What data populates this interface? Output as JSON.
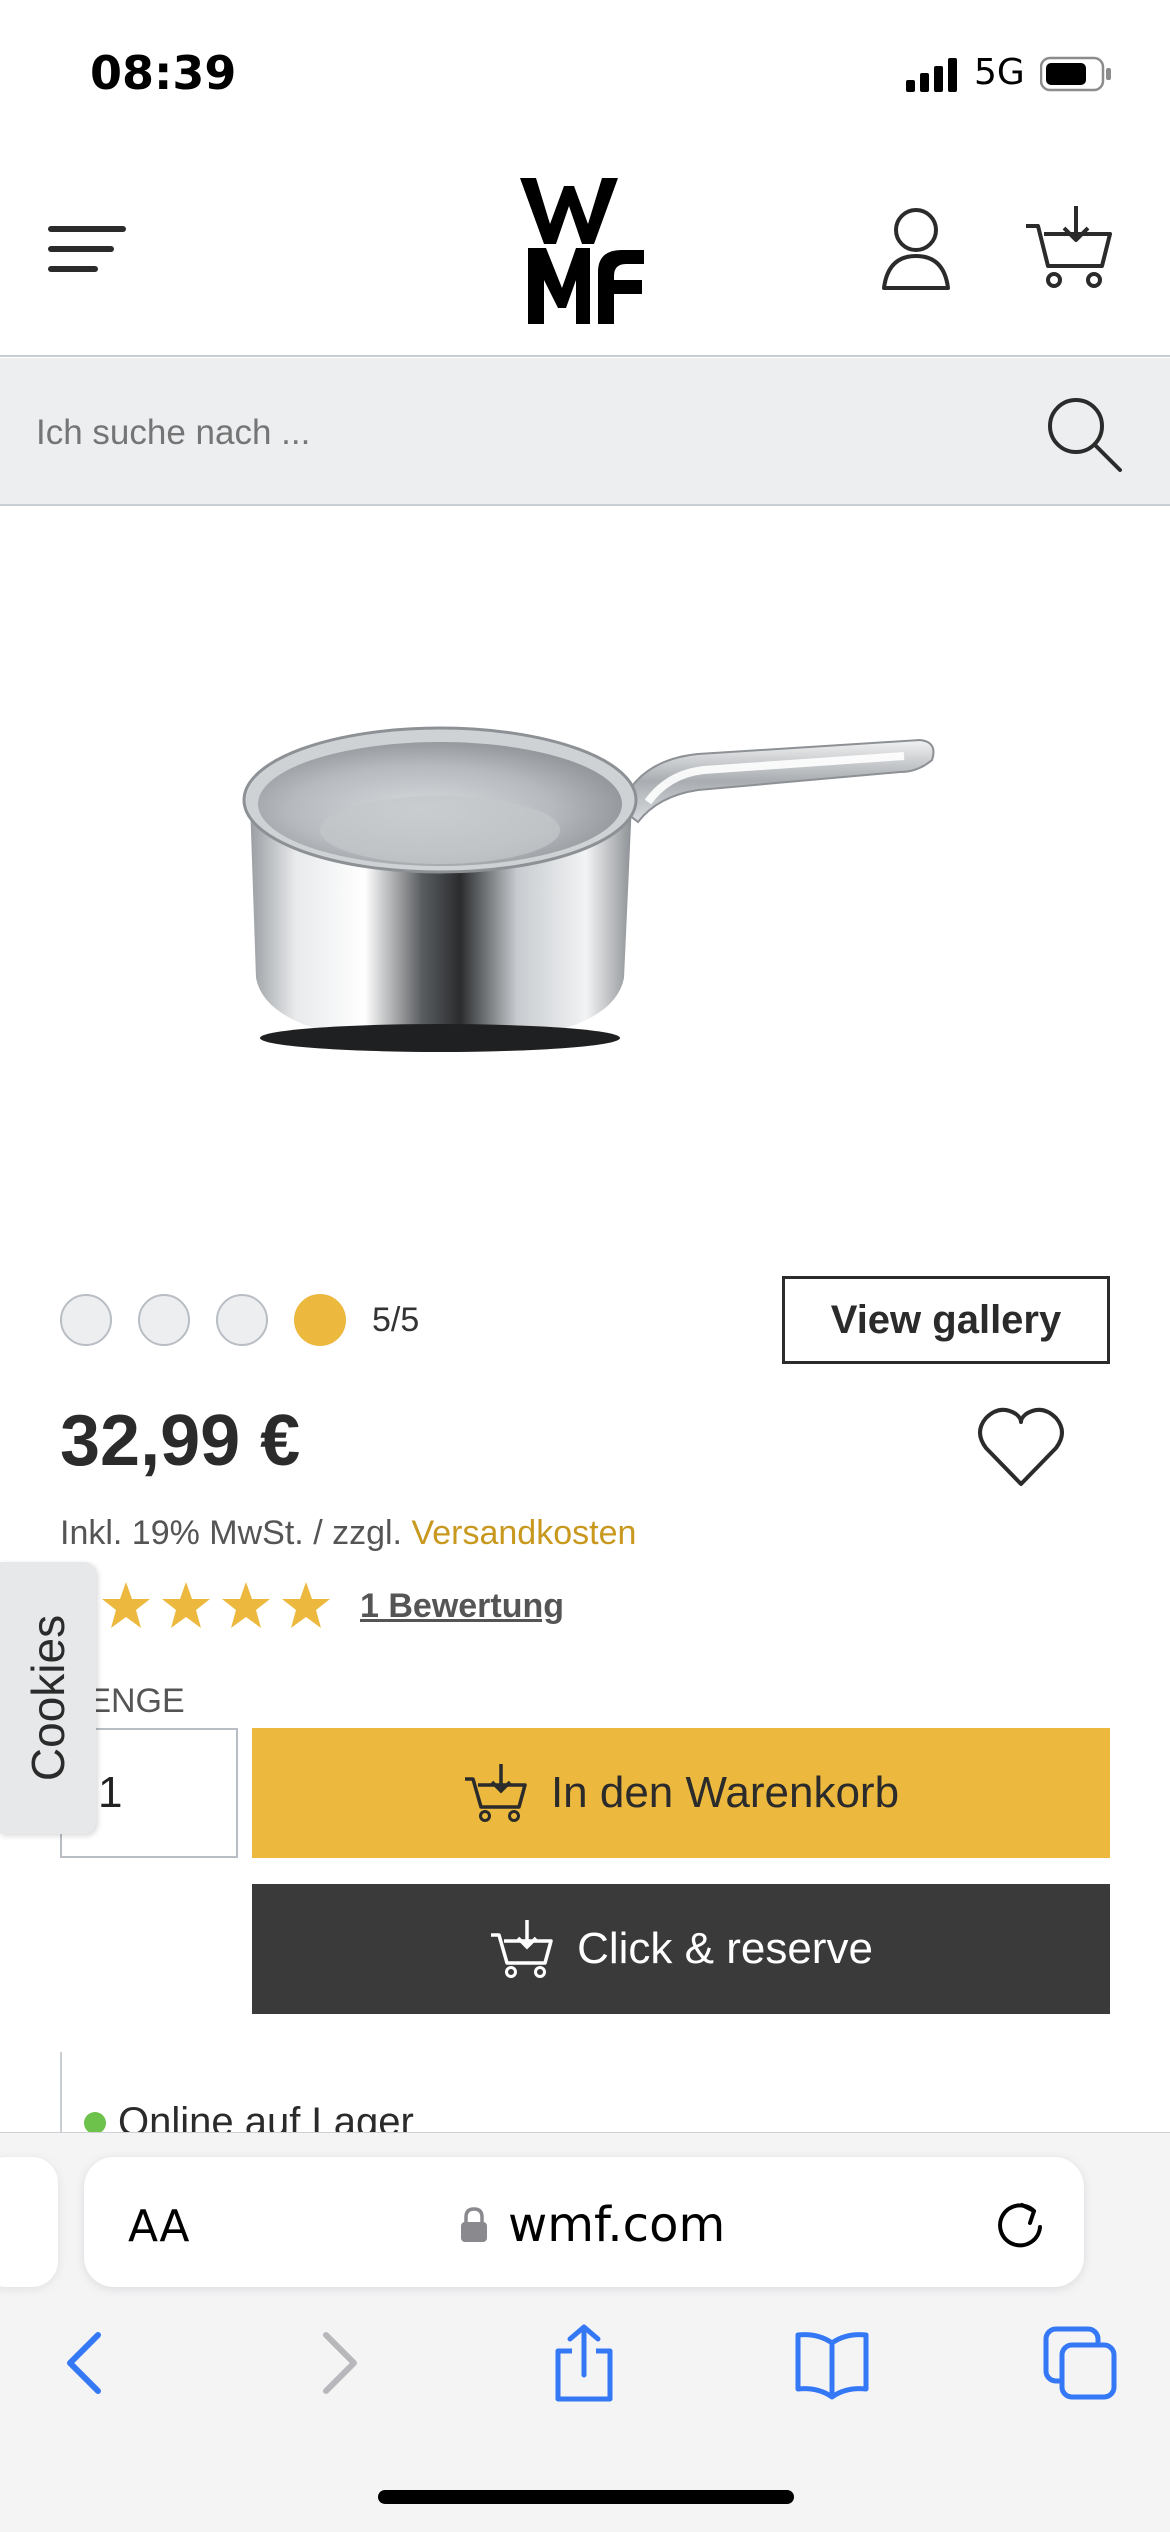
{
  "status_bar": {
    "time": "08:39",
    "network": "5G"
  },
  "brand": {
    "logo_text": "WMF",
    "accent": "#ecb93e",
    "dark": "#3a3a3a"
  },
  "search": {
    "placeholder": "Ich suche nach ..."
  },
  "gallery": {
    "counter": "5/5",
    "view_gallery_label": "View gallery",
    "active_index": 5,
    "total": 5
  },
  "product": {
    "price": "32,99 €",
    "tax_prefix": "Inkl. 19% MwSt. / zzgl.",
    "shipping_link": "Versandkosten",
    "rating_stars": 5,
    "reviews_label": "1 Bewertung"
  },
  "purchase": {
    "quantity_label": "MENGE",
    "quantity_value": "1",
    "add_to_cart_label": "In den Warenkorb",
    "click_reserve_label": "Click & reserve"
  },
  "stock": {
    "status": "Online auf Lager",
    "status_color": "#6cc24a"
  },
  "cookies": {
    "label": "Cookies"
  },
  "safari": {
    "text_size_label": "AA",
    "url": "wmf.com",
    "tint": "#3478f6"
  }
}
